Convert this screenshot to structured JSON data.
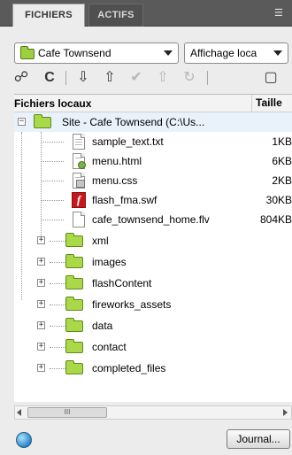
{
  "tabs": [
    {
      "label": "FICHIERS"
    },
    {
      "label": "ACTIFS"
    }
  ],
  "panel_menu_icon": "panel-options-icon",
  "site_dropdown": {
    "value": "Cafe Townsend"
  },
  "view_dropdown": {
    "value": "Affichage loca"
  },
  "toolbar": {
    "buttons": [
      {
        "name": "connect",
        "icon": "☍"
      },
      {
        "name": "refresh",
        "icon": "C"
      },
      {
        "name": "get",
        "icon": "⇩"
      },
      {
        "name": "put",
        "icon": "⇧"
      },
      {
        "name": "check-out",
        "icon": "✔"
      },
      {
        "name": "check-in",
        "icon": "⇧"
      },
      {
        "name": "sync",
        "icon": "↻"
      },
      {
        "name": "expand",
        "icon": "▢"
      }
    ]
  },
  "file_list": {
    "header_name": "Fichiers locaux",
    "header_size": "Taille",
    "root": {
      "label": "Site - Cafe Townsend (C:\\Us..."
    },
    "files": [
      {
        "name": "sample_text.txt",
        "size": "1KB",
        "type": "txt"
      },
      {
        "name": "menu.html",
        "size": "6KB",
        "type": "html"
      },
      {
        "name": "menu.css",
        "size": "2KB",
        "type": "css"
      },
      {
        "name": "flash_fma.swf",
        "size": "30KB",
        "type": "swf"
      },
      {
        "name": "cafe_townsend_home.flv",
        "size": "804KB",
        "type": "flv"
      }
    ],
    "folders": [
      {
        "name": "xml"
      },
      {
        "name": "images"
      },
      {
        "name": "flashContent"
      },
      {
        "name": "fireworks_assets"
      },
      {
        "name": "data"
      },
      {
        "name": "contact"
      },
      {
        "name": "completed_files"
      }
    ]
  },
  "scrollbar": {
    "thumb_label": "III"
  },
  "status": {
    "journal_label": "Journal..."
  }
}
